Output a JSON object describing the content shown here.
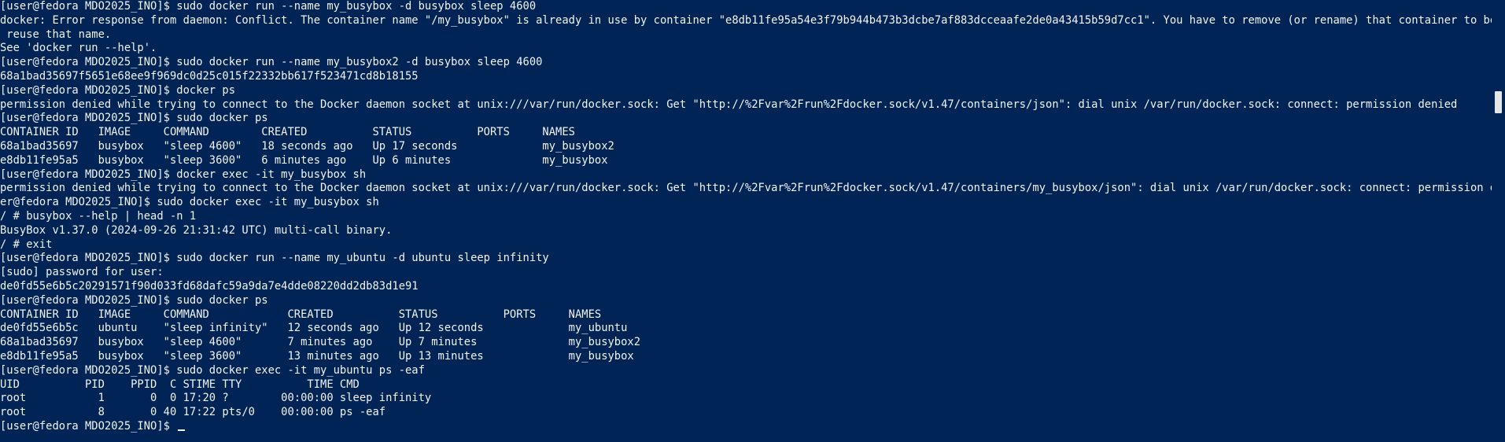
{
  "terminal": {
    "lines": [
      "[user@fedora MDO2025_INO]$ sudo docker run --name my_busybox -d busybox sleep 4600",
      "docker: Error response from daemon: Conflict. The container name \"/my_busybox\" is already in use by container \"e8db11fe95a54e3f79b944b473b3dcbe7af883dcceaafe2de0a43415b59d7cc1\". You have to remove (or rename) that container to be able to",
      " reuse that name.",
      "See 'docker run --help'.",
      "[user@fedora MDO2025_INO]$ sudo docker run --name my_busybox2 -d busybox sleep 4600",
      "68a1bad35697f5651e68ee9f969dc0d25c015f22332bb617f523471cd8b18155",
      "[user@fedora MDO2025_INO]$ docker ps",
      "permission denied while trying to connect to the Docker daemon socket at unix:///var/run/docker.sock: Get \"http://%2Fvar%2Frun%2Fdocker.sock/v1.47/containers/json\": dial unix /var/run/docker.sock: connect: permission denied",
      "[user@fedora MDO2025_INO]$ sudo docker ps",
      "CONTAINER ID   IMAGE     COMMAND        CREATED          STATUS          PORTS     NAMES",
      "68a1bad35697   busybox   \"sleep 4600\"   18 seconds ago   Up 17 seconds             my_busybox2",
      "e8db11fe95a5   busybox   \"sleep 3600\"   6 minutes ago    Up 6 minutes              my_busybox",
      "[user@fedora MDO2025_INO]$ docker exec -it my_busybox sh",
      "permission denied while trying to connect to the Docker daemon socket at unix:///var/run/docker.sock: Get \"http://%2Fvar%2Frun%2Fdocker.sock/v1.47/containers/my_busybox/json\": dial unix /var/run/docker.sock: connect: permission denied[us",
      "er@fedora MDO2025_INO]$ sudo docker exec -it my_busybox sh",
      "/ # busybox --help | head -n 1",
      "BusyBox v1.37.0 (2024-09-26 21:31:42 UTC) multi-call binary.",
      "/ # exit",
      "[user@fedora MDO2025_INO]$ sudo docker run --name my_ubuntu -d ubuntu sleep infinity",
      "[sudo] password for user:",
      "de0fd55e6b5c20291571f90d033fd68dafc59a9da7e4dde08220dd2db83d1e91",
      "[user@fedora MDO2025_INO]$ sudo docker ps",
      "CONTAINER ID   IMAGE     COMMAND            CREATED          STATUS          PORTS     NAMES",
      "de0fd55e6b5c   ubuntu    \"sleep infinity\"   12 seconds ago   Up 12 seconds             my_ubuntu",
      "68a1bad35697   busybox   \"sleep 4600\"       7 minutes ago    Up 7 minutes              my_busybox2",
      "e8db11fe95a5   busybox   \"sleep 3600\"       13 minutes ago   Up 13 minutes             my_busybox",
      "[user@fedora MDO2025_INO]$ sudo docker exec -it my_ubuntu ps -eaf",
      "UID          PID    PPID  C STIME TTY          TIME CMD",
      "root           1       0  0 17:20 ?        00:00:00 sleep infinity",
      "root           8       0 40 17:22 pts/0    00:00:00 ps -eaf"
    ],
    "prompt": "[user@fedora MDO2025_INO]$ "
  }
}
